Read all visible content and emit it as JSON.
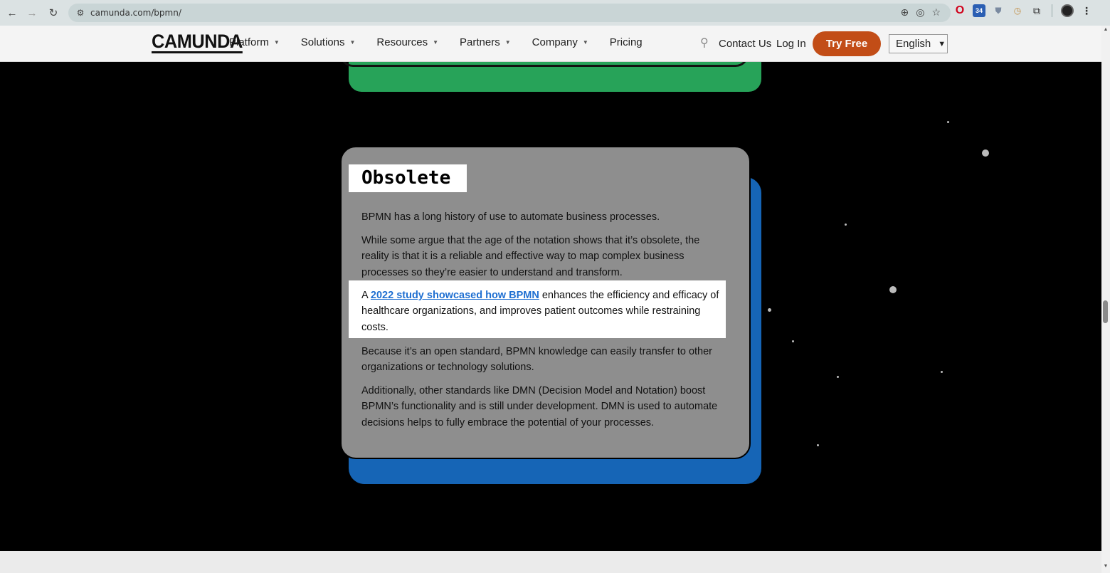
{
  "browser": {
    "url": "camunda.com/bpmn/"
  },
  "header": {
    "logo": "CAMUNDA",
    "nav": [
      "Platform",
      "Solutions",
      "Resources",
      "Partners",
      "Company",
      "Pricing"
    ],
    "contact": "Contact Us",
    "login": "Log In",
    "cta": "Try Free",
    "language": "English"
  },
  "card": {
    "title": "Obsolete",
    "p1": "BPMN has a long history of use to automate business processes.",
    "p2": "While some argue that the age of the notation shows that it’s obsolete, the reality is that it is a reliable and effective way to map complex business processes so they’re easier to understand and transform.",
    "p3_prefix": "A ",
    "p3_link": "2022 study showcased how BPMN",
    "p3_suffix": " enhances the efficiency and efficacy of healthcare organizations, and improves patient outcomes while restraining costs.",
    "p4": "Because it’s an open standard, BPMN knowledge can easily transfer to other organizations or technology solutions.",
    "p5": "Additionally, other standards like DMN (Decision Model and Notation) boost BPMN’s functionality and is still under development. DMN is used to automate decisions helps to fully embrace the potential of your processes."
  },
  "colors": {
    "cta": "#c24d17",
    "green_block": "#27a359",
    "blue_block": "#1665b6",
    "card": "#8e8e8e",
    "link": "#1f6fd1"
  }
}
